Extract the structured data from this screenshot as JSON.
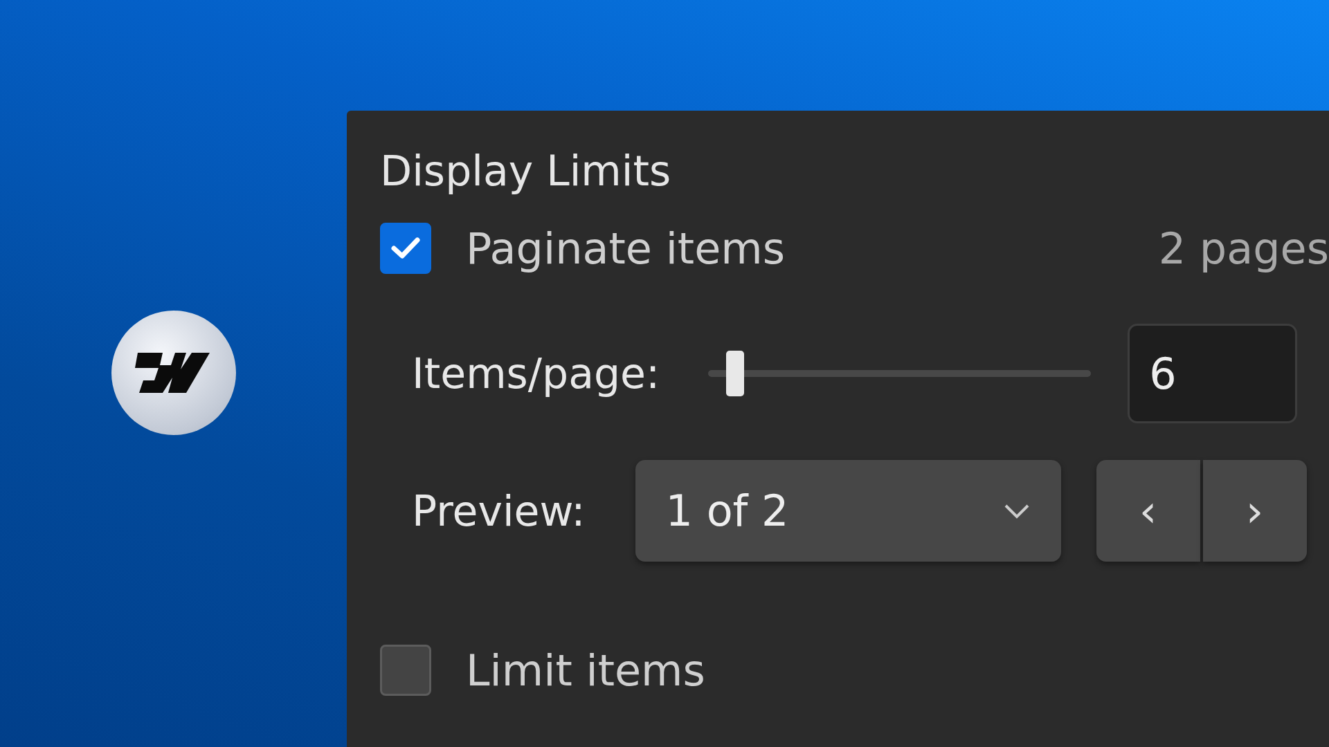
{
  "panel": {
    "title": "Display Limits",
    "paginate": {
      "label": "Paginate items",
      "checked": true,
      "pages": "2 pages"
    },
    "items_per_page": {
      "label": "Items/page:",
      "level": 0.07,
      "value": "6"
    },
    "preview": {
      "label": "Preview:",
      "value": "1 of 2",
      "prev": "‹",
      "next": "›"
    },
    "limit": {
      "label": "Limit items",
      "checked": false
    }
  }
}
